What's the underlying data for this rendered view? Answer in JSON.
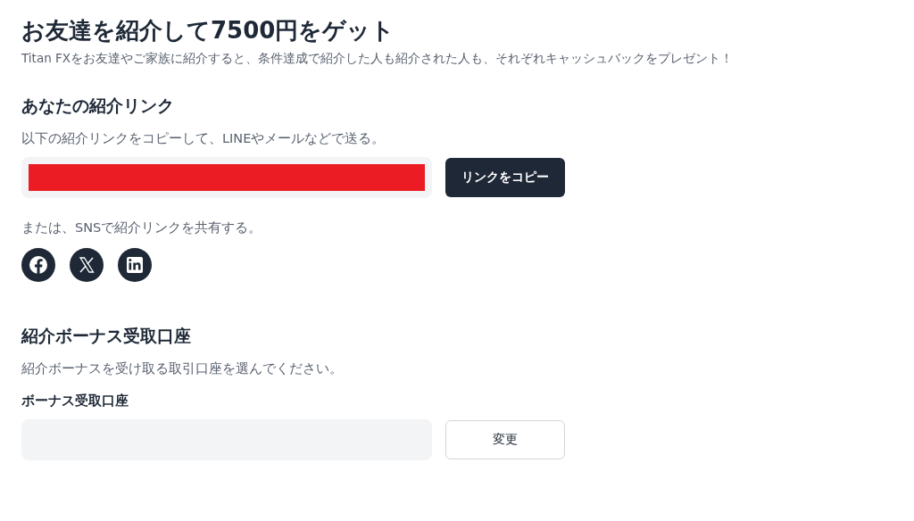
{
  "title": "お友達を紹介して7500円をゲット",
  "subtitle": "Titan FXをお友達やご家族に紹介すると、条件達成で紹介した人も紹介された人も、それぞれキャッシュバックをプレゼント！",
  "link_section": {
    "heading": "あなたの紹介リンク",
    "description": "以下の紹介リンクをコピーして、LINEやメールなどで送る。",
    "link_field": {
      "redacted": true
    },
    "copy_button": "リンクをコピー",
    "share_text": "または、SNSで紹介リンクを共有する。",
    "share_buttons": [
      {
        "kind": "facebook"
      },
      {
        "kind": "x"
      },
      {
        "kind": "linkedin"
      }
    ]
  },
  "account_section": {
    "heading": "紹介ボーナス受取口座",
    "description": "紹介ボーナスを受け取る取引口座を選んでください。",
    "field_label": "ボーナス受取口座",
    "change_button": "変更"
  }
}
